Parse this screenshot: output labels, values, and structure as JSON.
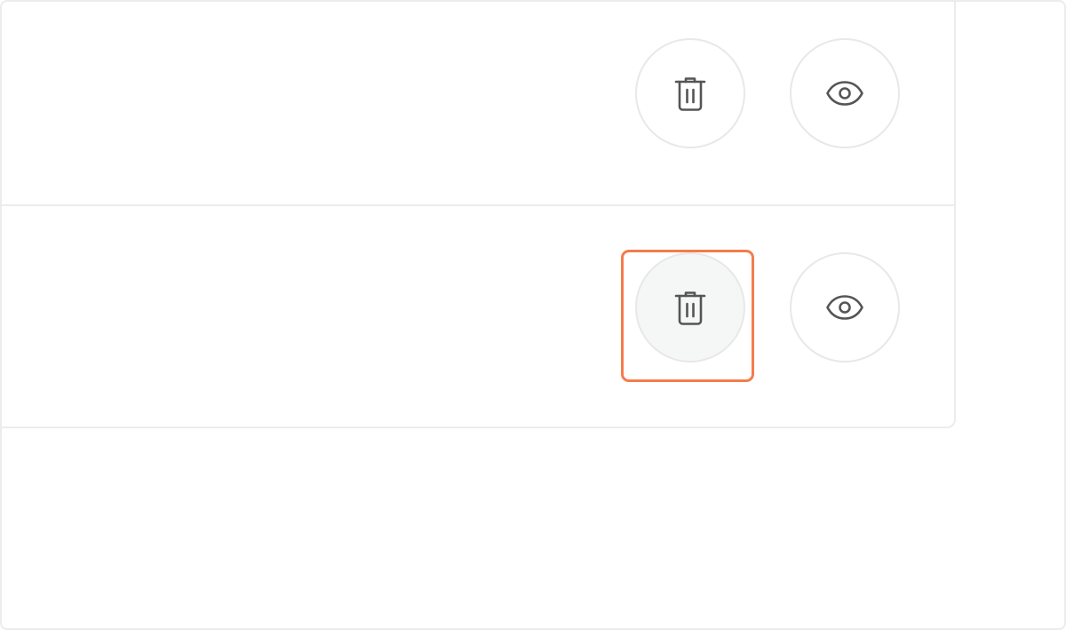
{
  "rows": [
    {
      "actions": [
        {
          "type": "delete",
          "icon": "trash-icon",
          "state": "default"
        },
        {
          "type": "view",
          "icon": "eye-icon",
          "state": "default"
        }
      ]
    },
    {
      "actions": [
        {
          "type": "delete",
          "icon": "trash-icon",
          "state": "hovered"
        },
        {
          "type": "view",
          "icon": "eye-icon",
          "state": "default"
        }
      ]
    }
  ],
  "highlight": {
    "target": "row-2-delete-button",
    "color": "#f47c4c"
  },
  "colors": {
    "border": "#ececec",
    "icon": "#555555",
    "hover_background": "#f5f6f6"
  }
}
